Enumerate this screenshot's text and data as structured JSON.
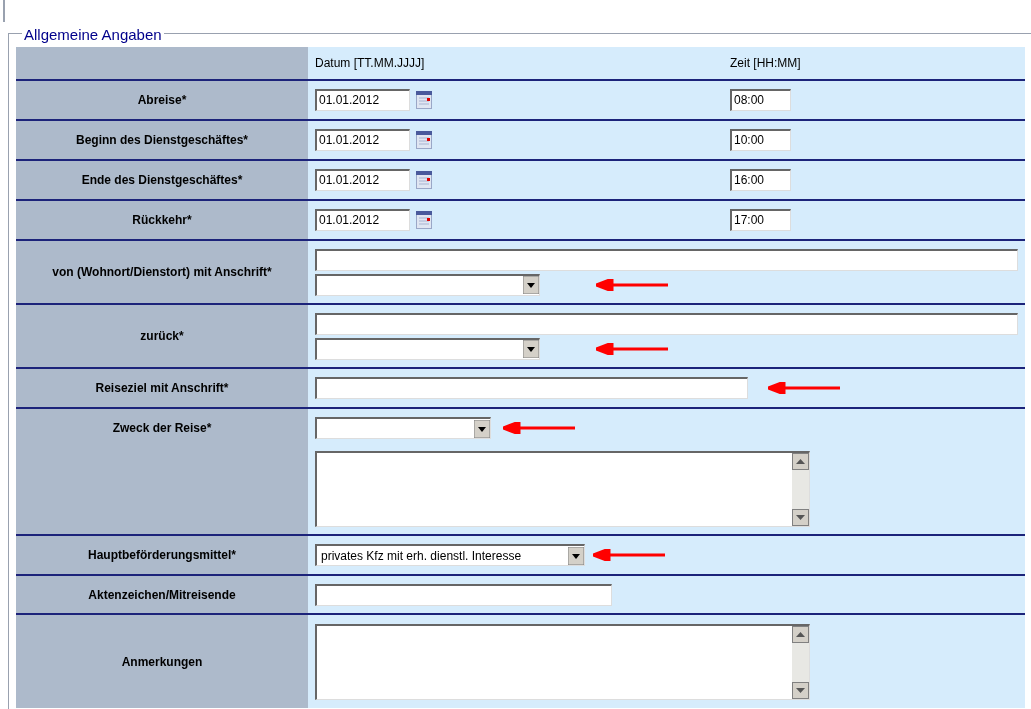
{
  "section": {
    "legend": "Allgemeine Angaben"
  },
  "header": {
    "date": "Datum [TT.MM.JJJJ]",
    "time": "Zeit [HH:MM]"
  },
  "rows": [
    {
      "kind": "datetime",
      "label": "Abreise*",
      "date": "01.01.2012",
      "time": "08:00",
      "arrow": false
    },
    {
      "kind": "datetime",
      "label": "Beginn des Dienstgeschäftes*",
      "date": "01.01.2012",
      "time": "10:00",
      "arrow": false
    },
    {
      "kind": "datetime",
      "label": "Ende des Dienstgeschäftes*",
      "date": "01.01.2012",
      "time": "16:00",
      "arrow": false
    },
    {
      "kind": "datetime",
      "label": "Rückkehr*",
      "date": "01.01.2012",
      "time": "17:00",
      "arrow": false
    },
    {
      "kind": "address",
      "label": "von (Wohnort/Dienstort) mit Anschrift*",
      "arrow": true
    },
    {
      "kind": "address",
      "label": "zurück*",
      "arrow": true
    },
    {
      "kind": "medium_text",
      "label": "Reiseziel mit Anschrift*",
      "arrow": true
    },
    {
      "kind": "select_notes",
      "label": "Zweck der Reise*",
      "arrow": true
    },
    {
      "kind": "select",
      "label": "Hauptbeförderungsmittel*",
      "value": "privates Kfz mit erh. dienstl. Interesse",
      "arrow": true
    },
    {
      "kind": "short_text",
      "label": "Aktenzeichen/Mitreisende",
      "arrow": false
    },
    {
      "kind": "notes",
      "label": "Anmerkungen",
      "arrow": false
    }
  ]
}
